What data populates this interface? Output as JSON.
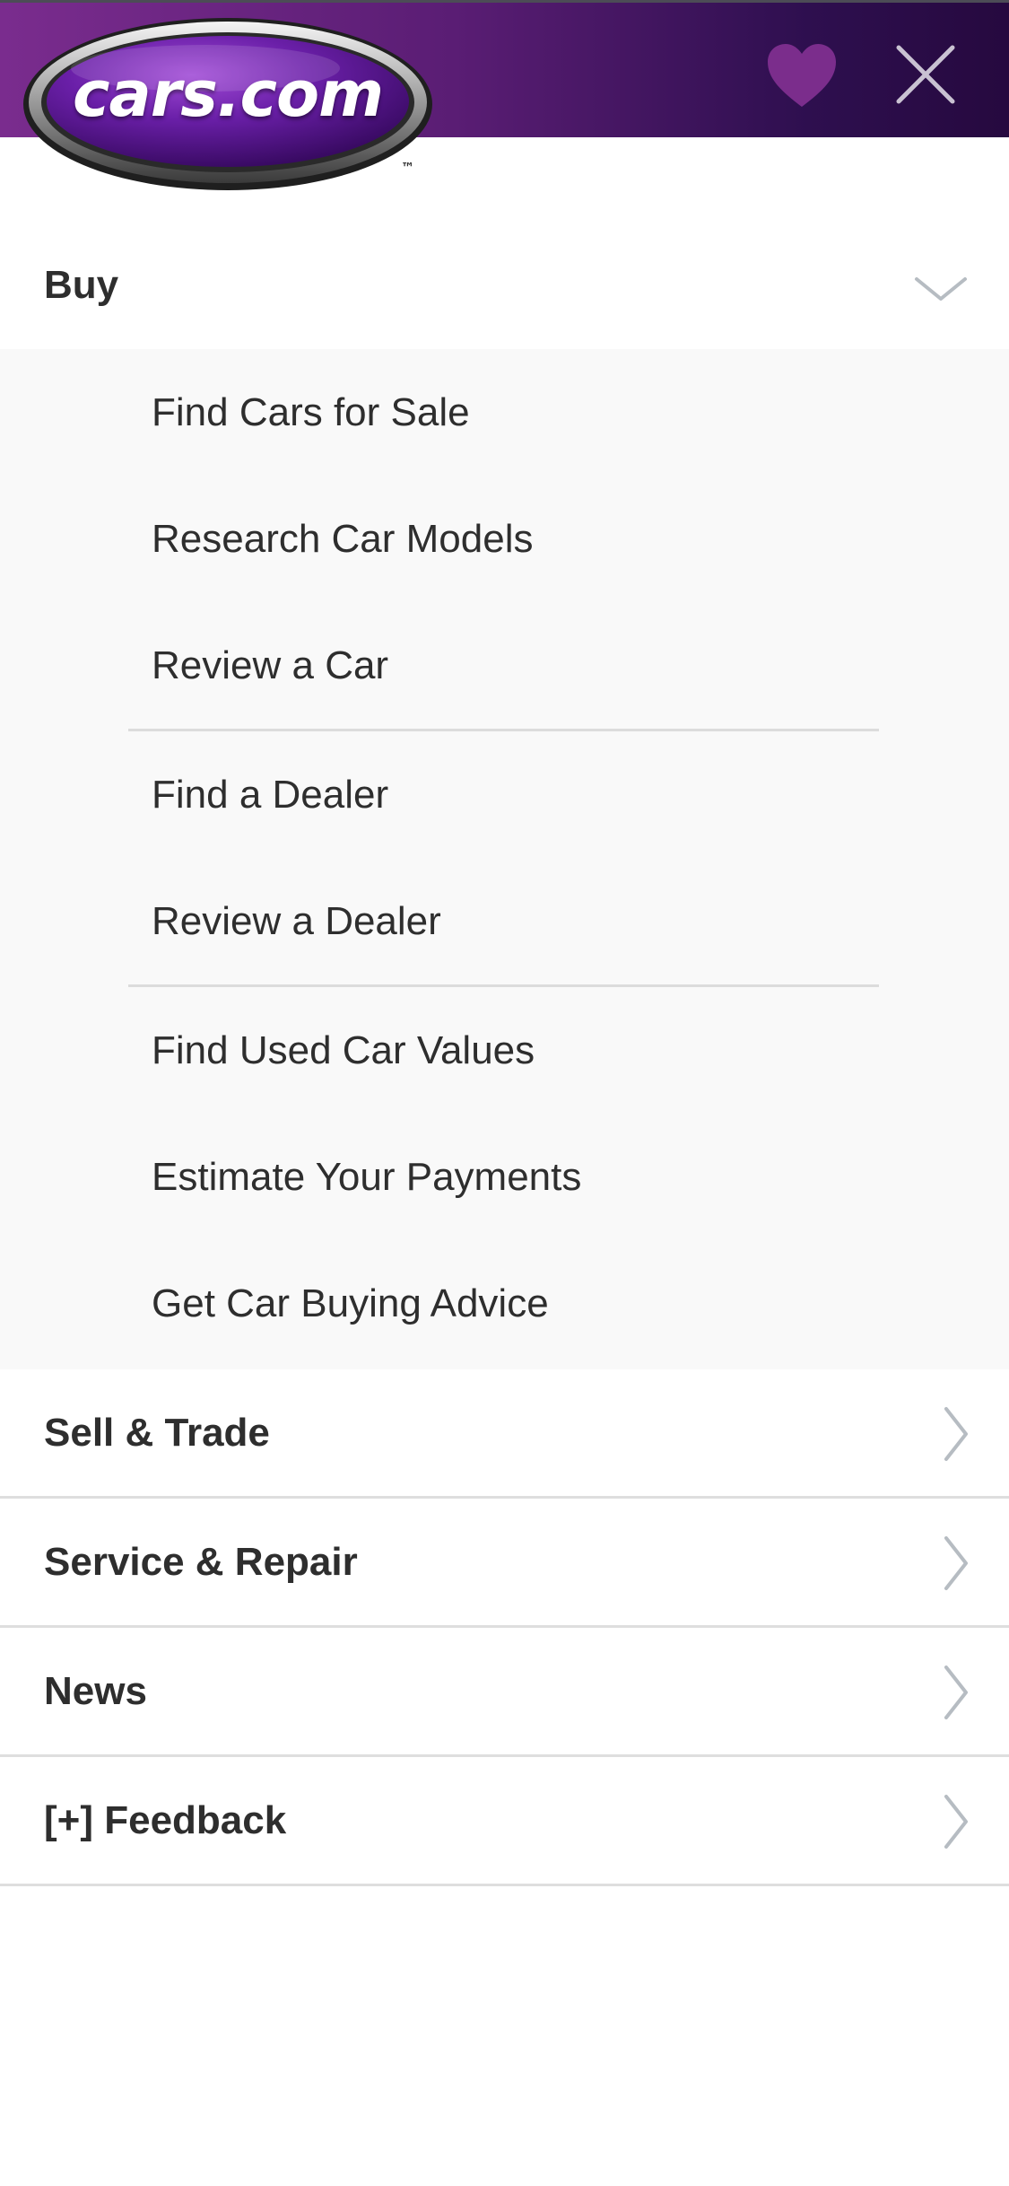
{
  "header": {
    "logo_text": "cars.com",
    "logo_tm": "™",
    "favorites_icon": "heart-icon",
    "close_icon": "close-icon",
    "colors": {
      "gradient_start": "#7a2c8e",
      "gradient_end": "#26093f",
      "heart": "#7b2d8c",
      "close": "#c9c2d2"
    }
  },
  "menu": {
    "buy": {
      "label": "Buy",
      "expanded": true,
      "icon": "chevron-down-icon",
      "items": [
        {
          "label": "Find Cars for Sale"
        },
        {
          "label": "Research Car Models"
        },
        {
          "label": "Review a Car"
        },
        {
          "label": "Find a Dealer"
        },
        {
          "label": "Review a Dealer"
        },
        {
          "label": "Find Used Car Values"
        },
        {
          "label": "Estimate Your Payments"
        },
        {
          "label": "Get Car Buying Advice"
        }
      ]
    },
    "sections": [
      {
        "label": "Sell & Trade",
        "icon": "chevron-right-icon"
      },
      {
        "label": "Service & Repair",
        "icon": "chevron-right-icon"
      },
      {
        "label": "News",
        "icon": "chevron-right-icon"
      },
      {
        "label": "[+] Feedback",
        "icon": "chevron-right-icon"
      }
    ]
  }
}
